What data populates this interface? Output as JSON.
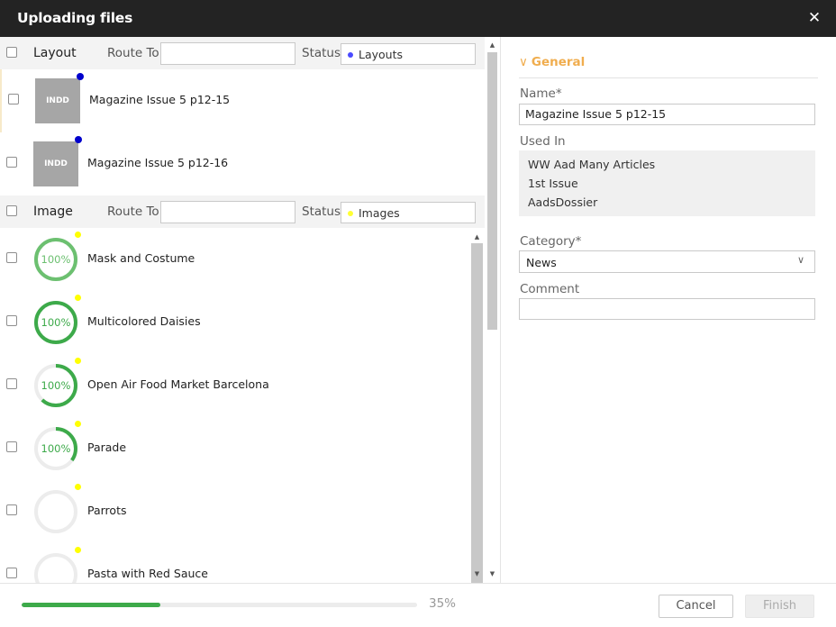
{
  "window": {
    "title": "Uploading files",
    "close_icon": "close-icon"
  },
  "groups": [
    {
      "name": "Layout",
      "route_label": "Route To",
      "route_value": "",
      "status_label": "Status",
      "status_value": "Layouts",
      "status_color": "#4a4aff",
      "items": [
        {
          "name": "Magazine Issue 5 p12-15",
          "thumb_text": "INDD",
          "indicator_color": "#0000cc"
        },
        {
          "name": "Magazine Issue 5 p12-16",
          "thumb_text": "INDD",
          "indicator_color": "#0000cc"
        }
      ]
    },
    {
      "name": "Image",
      "route_label": "Route To",
      "route_value": "",
      "status_label": "Status",
      "status_value": "Images",
      "status_color": "#ffff33",
      "items": [
        {
          "name": "Mask and Costume",
          "progress_label": "100%",
          "ring_fill": 1.0,
          "ring_color": "#6cc070",
          "indicator_color": "#ffff00"
        },
        {
          "name": "Multicolored Daisies",
          "progress_label": "100%",
          "ring_fill": 1.0,
          "ring_color": "#3daa4a",
          "indicator_color": "#ffff00"
        },
        {
          "name": "Open Air Food Market Barcelona",
          "progress_label": "100%",
          "ring_fill": 0.62,
          "ring_color": "#3daa4a",
          "indicator_color": "#ffff00"
        },
        {
          "name": "Parade",
          "progress_label": "100%",
          "ring_fill": 0.35,
          "ring_color": "#3daa4a",
          "indicator_color": "#ffff00"
        },
        {
          "name": "Parrots",
          "progress_label": "",
          "ring_fill": 0.0,
          "ring_color": "#3daa4a",
          "indicator_color": "#ffff00"
        },
        {
          "name": "Pasta with Red Sauce",
          "progress_label": "",
          "ring_fill": 0.0,
          "ring_color": "#3daa4a",
          "indicator_color": "#ffff00"
        }
      ]
    }
  ],
  "details": {
    "section_title": "General",
    "name_label": "Name*",
    "name_value": "Magazine Issue 5 p12-15",
    "used_in_label": "Used In",
    "used_in": [
      "WW Aad Many Articles",
      "1st Issue",
      "AadsDossier"
    ],
    "category_label": "Category*",
    "category_value": "News",
    "comment_label": "Comment",
    "comment_value": ""
  },
  "footer": {
    "progress_percent": 35,
    "progress_label": "35%",
    "cancel_label": "Cancel",
    "finish_label": "Finish"
  },
  "colors": {
    "accent_orange": "#f0ad4e",
    "progress_green": "#3daa4a",
    "titlebar_bg": "#232323"
  }
}
